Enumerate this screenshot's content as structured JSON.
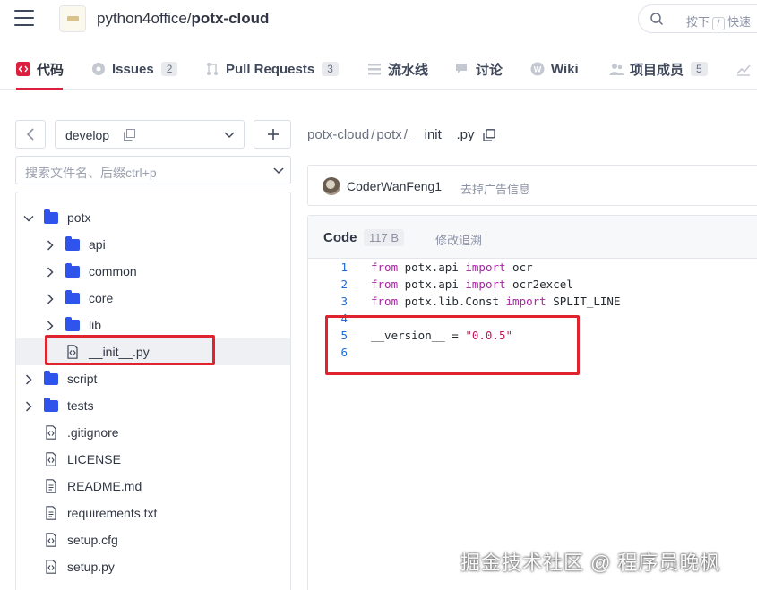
{
  "header": {
    "repo_owner": "python4office/",
    "repo_name": "potx-cloud",
    "search_hint_pre": "按下",
    "search_key": "/",
    "search_hint_post": "快速"
  },
  "nav": {
    "tabs": [
      {
        "label": "代码",
        "count": null,
        "icon": "code-icon",
        "active": true
      },
      {
        "label": "Issues",
        "count": "2",
        "icon": "issues-icon",
        "active": false
      },
      {
        "label": "Pull Requests",
        "count": "3",
        "icon": "pull-request-icon",
        "active": false
      },
      {
        "label": "流水线",
        "count": null,
        "icon": "pipeline-icon",
        "active": false
      },
      {
        "label": "讨论",
        "count": null,
        "icon": "discussion-icon",
        "active": false
      },
      {
        "label": "Wiki",
        "count": null,
        "icon": "wiki-icon",
        "active": false
      },
      {
        "label": "项目成员",
        "count": "5",
        "icon": "members-icon",
        "active": false
      }
    ]
  },
  "sidebar": {
    "branch": "develop",
    "file_search_placeholder": "搜索文件名、后缀ctrl+p",
    "tree": [
      {
        "name": "potx",
        "type": "folder",
        "expanded": true
      },
      {
        "name": "api",
        "type": "folder",
        "expanded": false
      },
      {
        "name": "common",
        "type": "folder",
        "expanded": false
      },
      {
        "name": "core",
        "type": "folder",
        "expanded": false
      },
      {
        "name": "lib",
        "type": "folder",
        "expanded": false
      },
      {
        "name": "__init__.py",
        "type": "code-file",
        "selected": true
      },
      {
        "name": "script",
        "type": "folder",
        "expanded": false
      },
      {
        "name": "tests",
        "type": "folder",
        "expanded": false
      },
      {
        "name": ".gitignore",
        "type": "code-file"
      },
      {
        "name": "LICENSE",
        "type": "code-file"
      },
      {
        "name": "README.md",
        "type": "text-file"
      },
      {
        "name": "requirements.txt",
        "type": "text-file"
      },
      {
        "name": "setup.cfg",
        "type": "code-file"
      },
      {
        "name": "setup.py",
        "type": "code-file"
      }
    ]
  },
  "breadcrumb": {
    "parts": [
      "potx-cloud",
      "potx",
      "__init__.py"
    ],
    "separator": "/"
  },
  "commit": {
    "author": "CoderWanFeng1",
    "message": "去掉广告信息"
  },
  "code_view": {
    "title": "Code",
    "size": "117 B",
    "blame_label": "修改追溯",
    "lines": [
      {
        "num": "1",
        "tokens": [
          {
            "t": "from",
            "k": "kw"
          },
          {
            "t": " potx.api ",
            "k": ""
          },
          {
            "t": "import",
            "k": "kw"
          },
          {
            "t": " ocr",
            "k": ""
          }
        ]
      },
      {
        "num": "2",
        "tokens": [
          {
            "t": "from",
            "k": "kw"
          },
          {
            "t": " potx.api ",
            "k": ""
          },
          {
            "t": "import",
            "k": "kw"
          },
          {
            "t": " ocr2excel",
            "k": ""
          }
        ]
      },
      {
        "num": "3",
        "tokens": [
          {
            "t": "from",
            "k": "kw"
          },
          {
            "t": " potx.lib.Const ",
            "k": ""
          },
          {
            "t": "import",
            "k": "kw"
          },
          {
            "t": " SPLIT_LINE",
            "k": ""
          }
        ]
      },
      {
        "num": "4",
        "tokens": []
      },
      {
        "num": "5",
        "tokens": [
          {
            "t": "__version__ = ",
            "k": ""
          },
          {
            "t": "\"0.0.5\"",
            "k": "str"
          }
        ]
      },
      {
        "num": "6",
        "tokens": []
      }
    ]
  },
  "watermark": "掘金技术社区 @ 程序员晚枫",
  "colors": {
    "accent": "#da203e",
    "folder": "#2f54eb",
    "line_number": "#1a6dd8",
    "keyword": "#a626a4",
    "string": "#c2185b",
    "highlight_box": "#e0242f"
  }
}
